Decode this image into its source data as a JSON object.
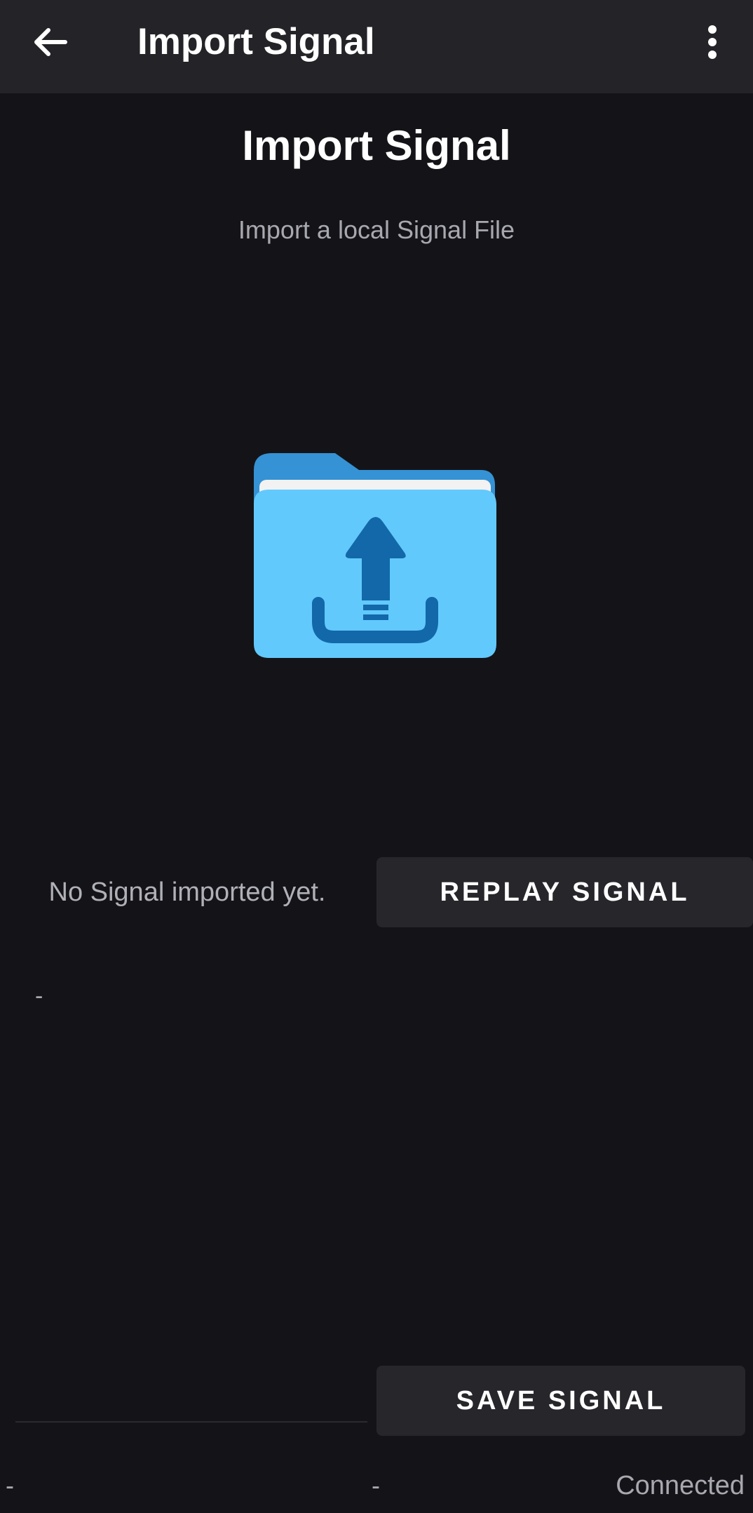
{
  "app_bar": {
    "title": "Import Signal",
    "back_icon": "arrow-back-icon",
    "menu_icon": "more-vert-icon"
  },
  "main": {
    "title": "Import Signal",
    "subtitle": "Import a local Signal File",
    "illustration_icon": "folder-upload-icon",
    "status_message": "No Signal imported yet.",
    "replay_button_label": "REPLAY SIGNAL",
    "signal_info": "-",
    "signal_name_input_value": "",
    "save_button_label": "SAVE SIGNAL"
  },
  "footer": {
    "left": "-",
    "middle": "-",
    "connection_status": "Connected"
  },
  "colors": {
    "background": "#141418",
    "app_bar": "#242428",
    "button": "#26262b",
    "folder_back": "#3592d4",
    "folder_front": "#62c9fc",
    "arrow": "#1268a8"
  }
}
